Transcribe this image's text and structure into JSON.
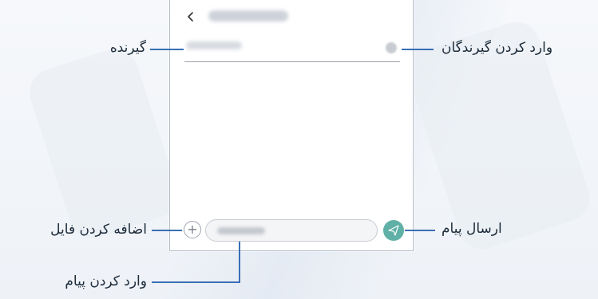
{
  "phone": {
    "back_icon": "chevron-left-icon",
    "attach_icon": "plus-icon",
    "send_icon": "paper-plane-icon",
    "send_color": "#5fb0a6"
  },
  "callouts": {
    "recipient": "گیرنده",
    "enter_recipients": "وارد کردن گیرندگان",
    "add_file": "اضافه کردن فایل",
    "send_message": "ارسال پیام",
    "enter_message": "وارد کردن پیام"
  },
  "colors": {
    "leader_line": "#3a6fb5",
    "text": "#1c2b3a"
  }
}
